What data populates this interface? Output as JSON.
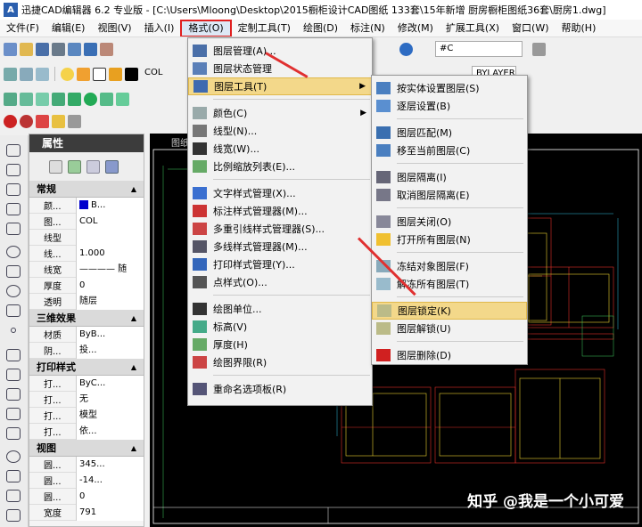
{
  "title": "迅捷CAD编辑器 6.2 专业版 - [C:\\Users\\Mloong\\Desktop\\2015橱柜设计CAD图纸 133套\\15年新增 厨房橱柜图纸36套\\厨房1.dwg]",
  "menubar": [
    "文件(F)",
    "编辑(E)",
    "视图(V)",
    "插入(I)",
    "格式(O)",
    "定制工具(T)",
    "绘图(D)",
    "标注(N)",
    "修改(M)",
    "扩展工具(X)",
    "窗口(W)",
    "帮助(H)"
  ],
  "toolbar": {
    "color_combo": "COL",
    "layer_combo": "BYLAYER",
    "search_value": "#C"
  },
  "props": {
    "title": "属性",
    "sections": [
      {
        "name": "常规",
        "rows": [
          [
            "颜...",
            "B..."
          ],
          [
            "图...",
            "COL"
          ],
          [
            "线型",
            ""
          ],
          [
            "线...",
            "1.000"
          ],
          [
            "线宽",
            "———— 随"
          ],
          [
            "厚度",
            "0"
          ],
          [
            "透明",
            "随层"
          ]
        ]
      },
      {
        "name": "三维效果",
        "rows": [
          [
            "材质",
            "ByB..."
          ],
          [
            "阴...",
            "投..."
          ]
        ]
      },
      {
        "name": "打印样式",
        "rows": [
          [
            "打...",
            "ByC..."
          ],
          [
            "打...",
            "无"
          ],
          [
            "打...",
            "模型"
          ],
          [
            "打...",
            "依..."
          ]
        ]
      },
      {
        "name": "视图",
        "rows": [
          [
            "圆...",
            "345..."
          ],
          [
            "圆...",
            "-14..."
          ],
          [
            "圆...",
            "0"
          ],
          [
            "宽度",
            "791"
          ]
        ]
      }
    ]
  },
  "drawing_tab": "图纸",
  "format_menu": {
    "items": [
      "图层管理(A)...",
      "图层状态管理",
      "图层工具(T)",
      "颜色(C)",
      "线型(N)...",
      "线宽(W)...",
      "比例缩放列表(E)...",
      "文字样式管理(X)...",
      "标注样式管理器(M)...",
      "多重引线样式管理器(S)...",
      "多线样式管理器(M)...",
      "打印样式管理(Y)...",
      "点样式(O)...",
      "绘图单位...",
      "标高(V)",
      "厚度(H)",
      "绘图界限(R)",
      "重命名选项板(R)"
    ]
  },
  "layer_tools_menu": {
    "items": [
      "按实体设置图层(S)",
      "逐层设置(B)",
      "图层匹配(M)",
      "移至当前图层(C)",
      "图层隔离(I)",
      "取消图层隔离(E)",
      "图层关闭(O)",
      "打开所有图层(N)",
      "冻结对象图层(F)",
      "解冻所有图层(T)",
      "图层锁定(K)",
      "图层解锁(U)",
      "图层删除(D)"
    ]
  },
  "watermark": "知乎 @我是一个小可爱",
  "colors": {
    "highlight": "#f3d88a",
    "menu_border_red": "#e02020",
    "drawing_bg": "#000000"
  }
}
